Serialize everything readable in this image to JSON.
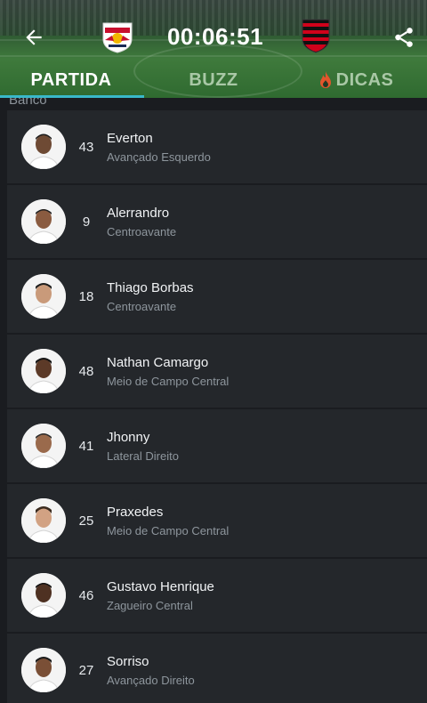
{
  "header": {
    "clock": "00:06:51",
    "home_crest_icon": "red-bull-bragantino-crest-icon",
    "away_crest_icon": "flamengo-crest-icon",
    "back_icon": "arrow-left-icon",
    "share_icon": "share-icon"
  },
  "tabs": [
    {
      "label": "PARTIDA",
      "active": true
    },
    {
      "label": "BUZZ",
      "active": false
    },
    {
      "label": "DICAS",
      "active": false,
      "icon": "fire-icon"
    }
  ],
  "colors": {
    "accent": "#39b8c9",
    "fire": "#e2552c",
    "row_bg": "#24272b"
  },
  "section_label": "Banco",
  "players": [
    {
      "number": "43",
      "name": "Everton",
      "position": "Avançado Esquerdo"
    },
    {
      "number": "9",
      "name": "Alerrandro",
      "position": "Centroavante"
    },
    {
      "number": "18",
      "name": "Thiago Borbas",
      "position": "Centroavante"
    },
    {
      "number": "48",
      "name": "Nathan Camargo",
      "position": "Meio de Campo Central"
    },
    {
      "number": "41",
      "name": "Jhonny",
      "position": "Lateral Direito"
    },
    {
      "number": "25",
      "name": "Praxedes",
      "position": "Meio de Campo Central"
    },
    {
      "number": "46",
      "name": "Gustavo Henrique",
      "position": "Zagueiro Central"
    },
    {
      "number": "27",
      "name": "Sorriso",
      "position": "Avançado Direito"
    }
  ]
}
